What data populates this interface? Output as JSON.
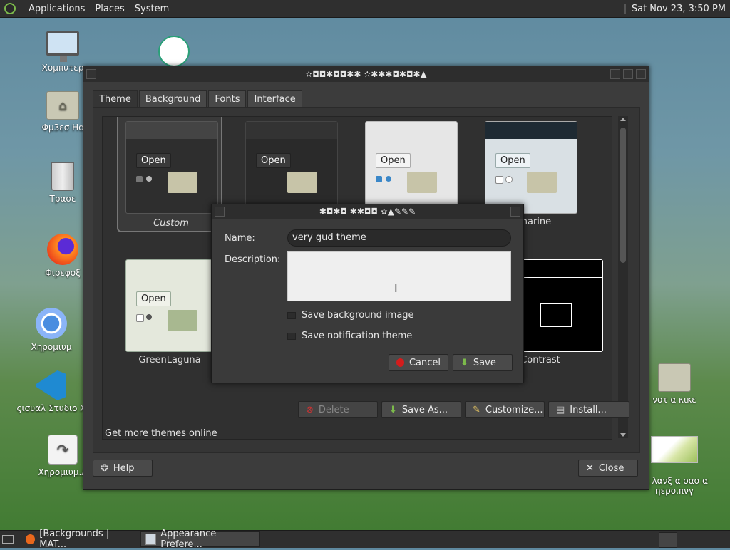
{
  "top_panel": {
    "menus": [
      "Applications",
      "Places",
      "System"
    ],
    "clock": "Sat Nov 23,  3:50 PM"
  },
  "desktop_icons": [
    {
      "label": "Χομπυτερ",
      "icon": "computer-icon"
    },
    {
      "label": "Φμ3εσ Ηο",
      "icon": "home-folder-icon"
    },
    {
      "label": "Τρασε",
      "icon": "trash-icon"
    },
    {
      "label": "Φιρεφοξ",
      "icon": "firefox-icon"
    },
    {
      "label": "Χηρομιυμ",
      "icon": "chromium-icon"
    },
    {
      "label": "ςισυαλ Στυδιο Χ",
      "icon": "vscode-icon"
    },
    {
      "label": "Χηρομιυμ.Α",
      "icon": "app-icon"
    },
    {
      "label": "νοτ α κικε",
      "icon": "folder-icon"
    },
    {
      "label": "ιμ λανξ α οασ α\nηερο.πνγ",
      "icon": "image-thumb-icon"
    }
  ],
  "main_window": {
    "title": "✫◘◘✱◘◘✱✱ ✫✱✱✱◘✱◘✱▲",
    "tabs": [
      "Theme",
      "Background",
      "Fonts",
      "Interface"
    ],
    "active_tab": "Theme",
    "themes": [
      {
        "name": "Custom",
        "selected": true,
        "style": "dark"
      },
      {
        "name": "",
        "style": "dark2"
      },
      {
        "name": "",
        "style": "light"
      },
      {
        "name": "ubmarine",
        "style": "submarine"
      },
      {
        "name": "GreenLaguna",
        "style": "green"
      },
      {
        "name": "Contrast",
        "style": "contrast"
      }
    ],
    "mini_open_label": "Open",
    "get_more": "Get more themes online",
    "buttons": {
      "delete": "Delete",
      "save_as": "Save As...",
      "customize": "Customize...",
      "install": "Install...",
      "help": "Help",
      "close": "Close"
    }
  },
  "dialog": {
    "title": "✱◘✱◘ ✱✱◘◘ ✫▲✎✎✎",
    "name_label": "Name:",
    "name_value": "very gud theme",
    "description_label": "Description:",
    "description_value": "",
    "checkboxes": [
      "Save background image",
      "Save notification theme"
    ],
    "cancel": "Cancel",
    "save": "Save"
  },
  "taskbar": {
    "items": [
      {
        "label": "[Backgrounds | MAT...",
        "icon": "firefox-icon",
        "active": false
      },
      {
        "label": "Appearance Prefere...",
        "icon": "appearance-icon",
        "active": true
      }
    ]
  },
  "colors": {
    "panel": "#2f2f2f",
    "window_bg": "#3c3c3c",
    "accent_green": "#7cba4b",
    "cancel_red": "#d41c1c"
  }
}
